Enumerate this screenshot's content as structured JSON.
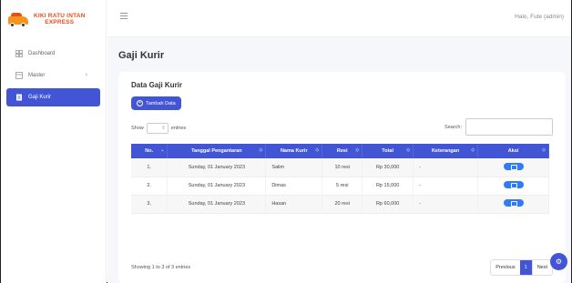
{
  "brand": {
    "line1": "KIKI RATU INTAN",
    "line2": "EXPRESS"
  },
  "sidebar": {
    "items": [
      {
        "label": "Dashboard",
        "icon": "grid-icon"
      },
      {
        "label": "Master",
        "icon": "table-icon"
      },
      {
        "label": "Gaji Kurir",
        "icon": "document-icon",
        "active": true
      }
    ]
  },
  "topbar": {
    "greeting": "Halo, Fute (admin)"
  },
  "page": {
    "title": "Gaji Kurir"
  },
  "card": {
    "title": "Data Gaji Kurir",
    "add_label": "Tambah Data",
    "show_label": "Show",
    "entries_label": "entries",
    "search_label": "Search:"
  },
  "table": {
    "headers": [
      "No.",
      "Tanggal Pengantaran",
      "Nama Kurir",
      "Resi",
      "Total",
      "Keterangan",
      "Aksi"
    ],
    "rows": [
      {
        "no": "1.",
        "tanggal": "Sunday, 01 January 2023",
        "nama": "Salim",
        "resi": "10 resi",
        "total": "Rp 30,000",
        "keterangan": "-"
      },
      {
        "no": "2.",
        "tanggal": "Sunday, 01 January 2023",
        "nama": "Dimas",
        "resi": "5 resi",
        "total": "Rp 15,000",
        "keterangan": "-"
      },
      {
        "no": "3.",
        "tanggal": "Sunday, 01 January 2023",
        "nama": "Hasan",
        "resi": "20 resi",
        "total": "Rp 60,000",
        "keterangan": "-"
      }
    ]
  },
  "footer": {
    "info": "Showing 1 to 3 of 3 entries",
    "previous": "Previous",
    "current_page": "1",
    "next": "Next"
  },
  "colors": {
    "accent": "#4255d4",
    "brand": "#e94e1b",
    "edit": "#2f7cf6"
  }
}
